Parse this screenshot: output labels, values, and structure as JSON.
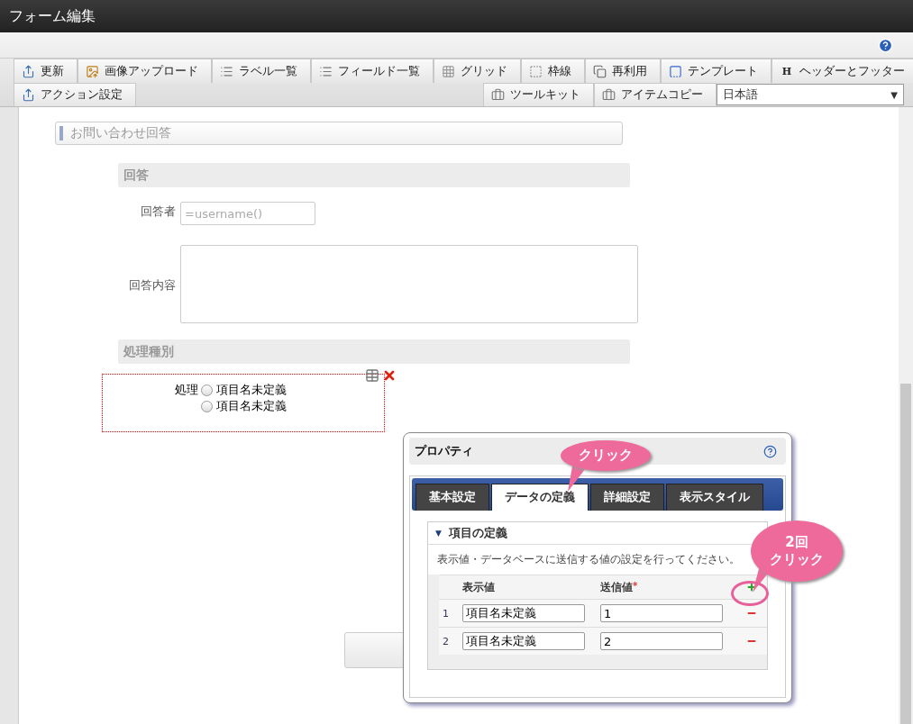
{
  "window": {
    "title": "フォーム編集"
  },
  "toolbar": {
    "row_1": [
      {
        "label": "更新"
      },
      {
        "label": "画像アップロード"
      },
      {
        "label": "ラベル一覧"
      },
      {
        "label": "フィールド一覧"
      },
      {
        "label": "グリッド"
      },
      {
        "label": "枠線"
      },
      {
        "label": "再利用"
      },
      {
        "label": "テンプレート"
      },
      {
        "label": "ヘッダーとフッター",
        "glyph": "H"
      }
    ],
    "row_2_left": [
      {
        "label": "アクション設定"
      }
    ],
    "row_2_right": [
      {
        "label": "ツールキット"
      },
      {
        "label": "アイテムコピー"
      }
    ],
    "language_select": {
      "value": "日本語",
      "arrow": "▼"
    }
  },
  "form": {
    "section_title": "お問い合わせ回答",
    "answer_header": "回答",
    "respondent": {
      "label": "回答者",
      "placeholder": "=username()"
    },
    "content": {
      "label": "回答内容"
    },
    "type_header": "処理種別",
    "process": {
      "label": "処理",
      "options": [
        {
          "label": "項目名未定義",
          "selected": false
        },
        {
          "label": "項目名未定義",
          "selected": false
        }
      ]
    }
  },
  "popup": {
    "title": "プロパティ",
    "tabs": [
      {
        "label": "基本設定",
        "selected": false
      },
      {
        "label": "データの定義",
        "selected": true
      },
      {
        "label": "詳細設定",
        "selected": false
      },
      {
        "label": "表示スタイル",
        "selected": false
      }
    ],
    "section": {
      "title": "項目の定義",
      "expanded": true,
      "arrow": "▼",
      "description": "表示値・データベースに送信する値の設定を行ってください。",
      "columns": [
        "表示値",
        "送信値"
      ],
      "required_mark": "*",
      "rows": [
        {
          "number": "1",
          "display": "項目名未定義",
          "value": "1"
        },
        {
          "number": "2",
          "display": "項目名未定義",
          "value": "2"
        }
      ]
    }
  },
  "callouts": [
    {
      "lines": [
        "クリック"
      ]
    },
    {
      "lines": [
        "2回",
        "クリック"
      ]
    }
  ]
}
